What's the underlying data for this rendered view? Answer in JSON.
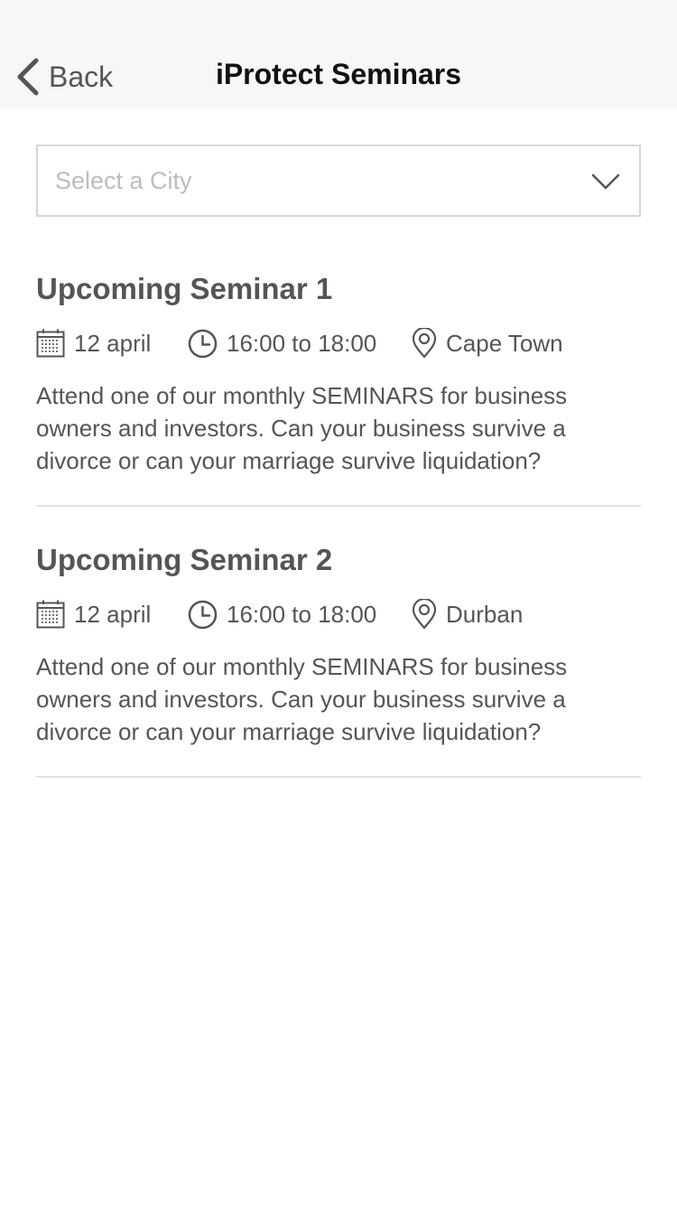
{
  "header": {
    "back_label": "Back",
    "title": "iProtect Seminars"
  },
  "city_select": {
    "placeholder": "Select a City"
  },
  "seminars": [
    {
      "title": "Upcoming Seminar 1",
      "date": "12 april",
      "time": "16:00 to 18:00",
      "location": "Cape Town",
      "description": "Attend one of our monthly SEMINARS for business owners and investors. Can your business survive a divorce or can your marriage survive liquidation?"
    },
    {
      "title": "Upcoming Seminar 2",
      "date": "12 april",
      "time": "16:00 to 18:00",
      "location": "Durban",
      "description": "Attend one of our monthly SEMINARS for business owners and investors. Can your business survive a divorce or can your marriage survive liquidation?"
    }
  ],
  "icons": {
    "back": "chevron-left-icon",
    "dropdown": "chevron-down-icon",
    "date": "calendar-icon",
    "time": "clock-icon",
    "location": "map-pin-icon"
  },
  "colors": {
    "nav_background": "#f7f7f7",
    "text": "#555555",
    "title": "#111111",
    "placeholder": "#bdbdbd",
    "border": "#d6d6d6"
  }
}
